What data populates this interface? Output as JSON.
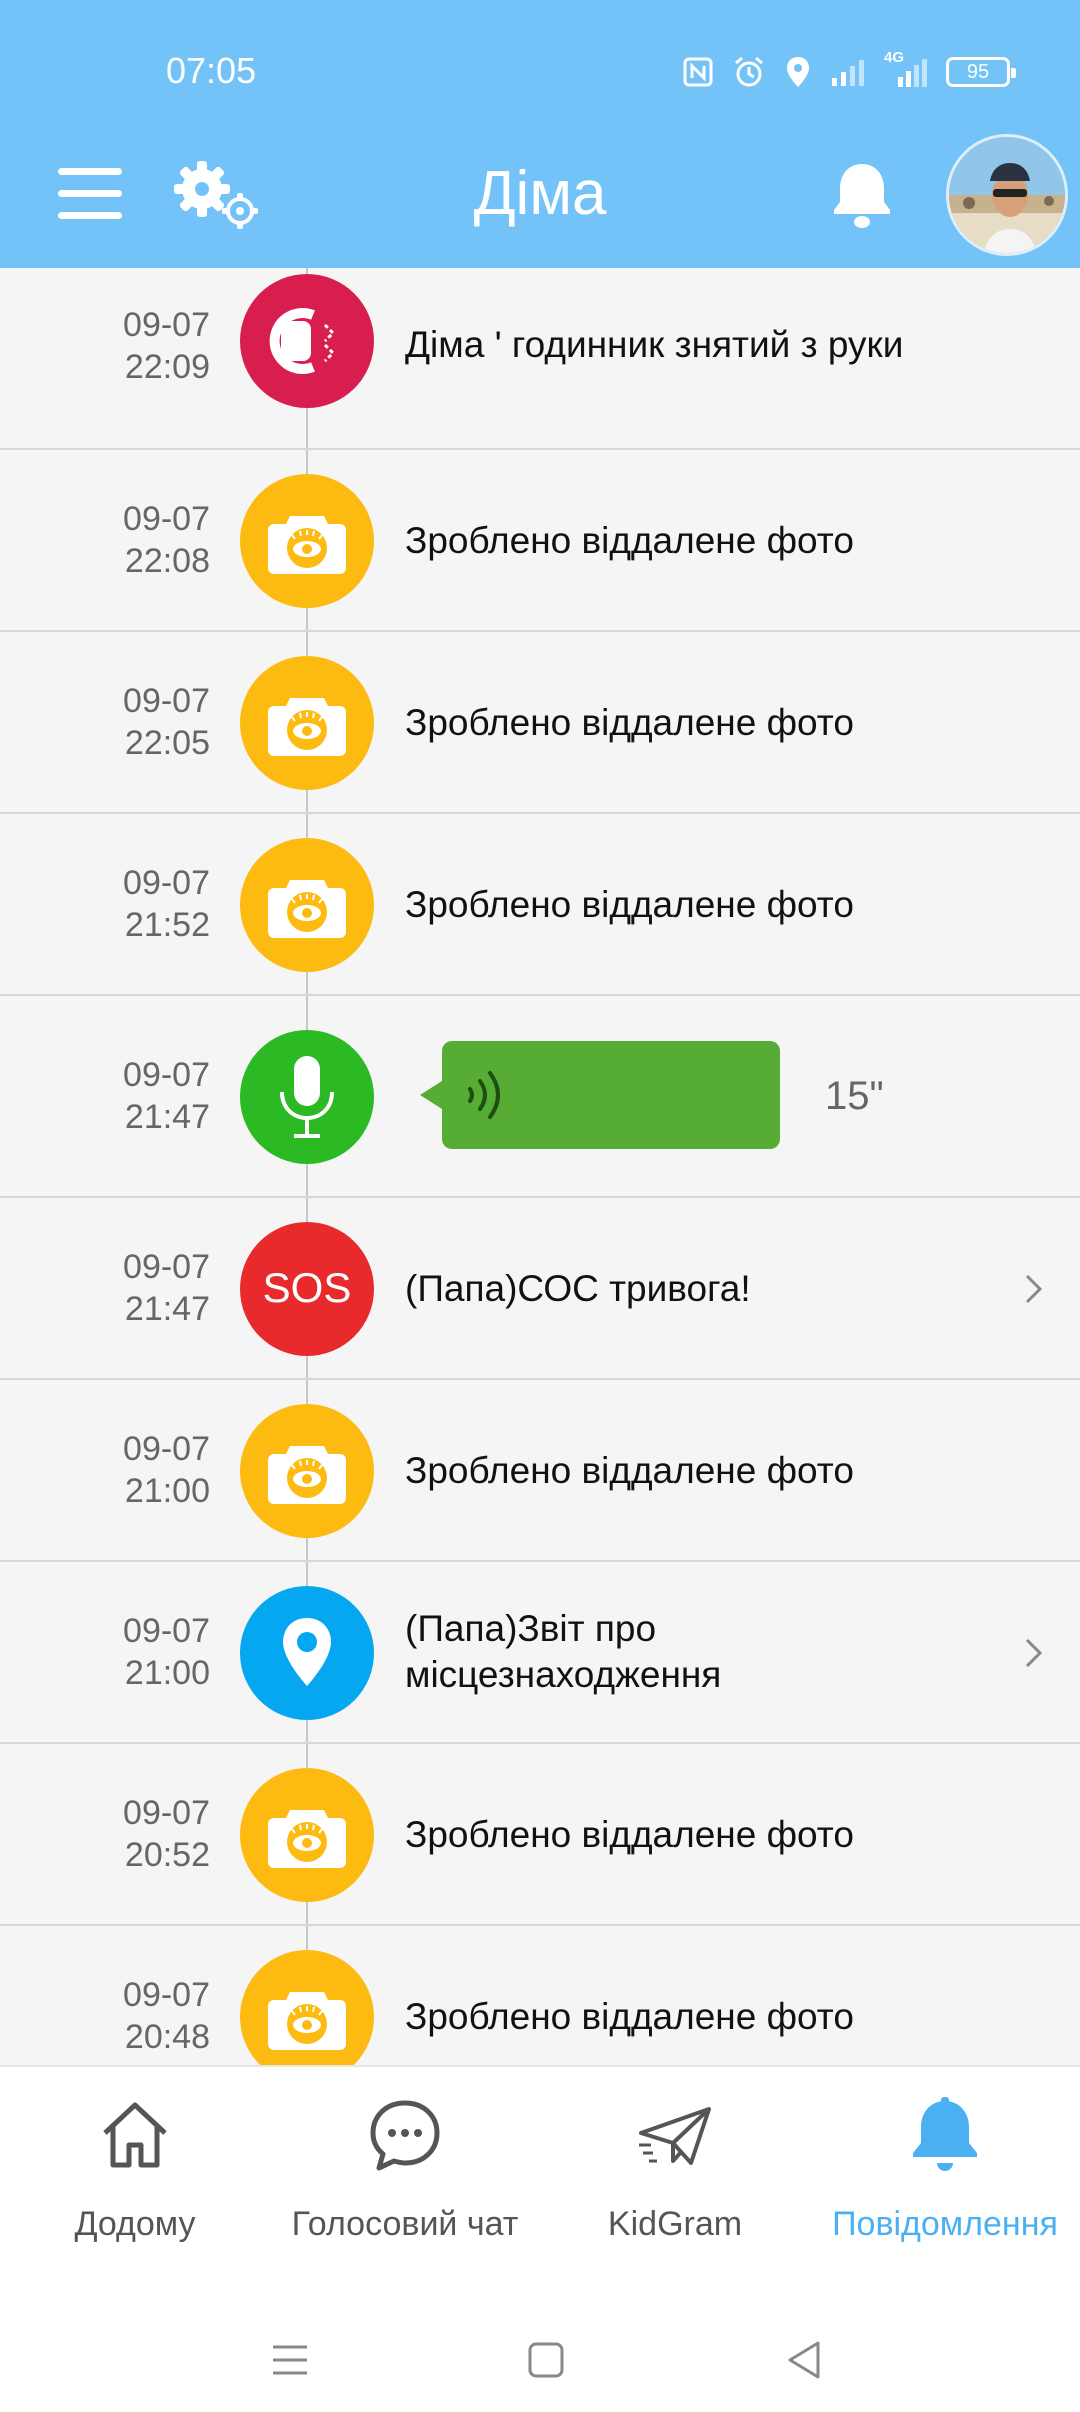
{
  "status_bar": {
    "time": "07:05",
    "network": "4G",
    "battery": "95"
  },
  "header": {
    "title": "Діма"
  },
  "colors": {
    "header_bg": "#74c3f8",
    "watch_off": "#d81e4e",
    "camera": "#fdbb11",
    "voice": "#2bba23",
    "sos": "#e82a2d",
    "location": "#05a8f0",
    "voice_bar": "#56ac34",
    "active_tab": "#4ab0f2"
  },
  "notifications": [
    {
      "type": "watch-off",
      "icon": "watch-off-icon",
      "date": "09-07",
      "time": "22:09",
      "text": "Діма ' годинник знятий з руки"
    },
    {
      "type": "photo",
      "icon": "camera-eye-icon",
      "date": "09-07",
      "time": "22:08",
      "text": "Зроблено віддалене фото"
    },
    {
      "type": "photo",
      "icon": "camera-eye-icon",
      "date": "09-07",
      "time": "22:05",
      "text": "Зроблено віддалене фото"
    },
    {
      "type": "photo",
      "icon": "camera-eye-icon",
      "date": "09-07",
      "time": "21:52",
      "text": "Зроблено віддалене фото"
    },
    {
      "type": "voice",
      "icon": "microphone-icon",
      "date": "09-07",
      "time": "21:47",
      "duration": "15\""
    },
    {
      "type": "sos",
      "icon": "sos-icon",
      "date": "09-07",
      "time": "21:47",
      "text": "(Папа)СОС тривога!"
    },
    {
      "type": "photo",
      "icon": "camera-eye-icon",
      "date": "09-07",
      "time": "21:00",
      "text": "Зроблено віддалене фото"
    },
    {
      "type": "location",
      "icon": "location-pin-icon",
      "date": "09-07",
      "time": "21:00",
      "text": "(Папа)Звіт про\nмісцезнаходження"
    },
    {
      "type": "photo",
      "icon": "camera-eye-icon",
      "date": "09-07",
      "time": "20:52",
      "text": "Зроблено віддалене фото"
    },
    {
      "type": "photo",
      "icon": "camera-eye-icon",
      "date": "09-07",
      "time": "20:48",
      "text": "Зроблено віддалене фото"
    }
  ],
  "bottom_nav": [
    {
      "label": "Додому",
      "icon": "home-icon"
    },
    {
      "label": "Голосовий чат",
      "icon": "chat-bubble-icon"
    },
    {
      "label": "KidGram",
      "icon": "paper-plane-icon"
    },
    {
      "label": "Повідомлення",
      "icon": "bell-icon",
      "active": true
    }
  ]
}
